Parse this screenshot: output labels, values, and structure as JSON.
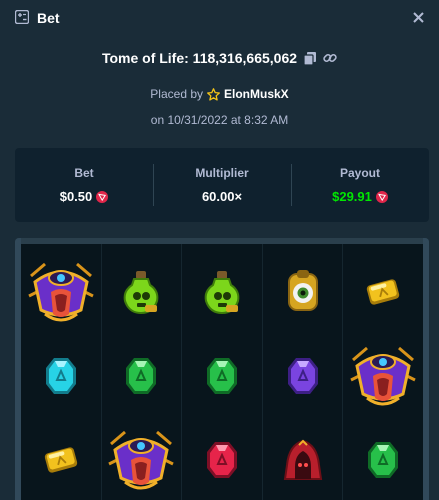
{
  "header": {
    "title": "Bet",
    "icon": "bet-icon",
    "close_icon": "close-icon"
  },
  "game": {
    "title": "Tome of Life: 118,316,665,062",
    "copy_icon": "copy-icon",
    "link_icon": "link-icon"
  },
  "placed": {
    "prefix": "Placed by",
    "user": "ElonMuskX",
    "user_icon": "star-icon"
  },
  "date": "on 10/31/2022 at 8:32 AM",
  "stats": {
    "bet": {
      "label": "Bet",
      "value": "$0.50"
    },
    "multiplier": {
      "label": "Multiplier",
      "value": "60.00×"
    },
    "payout": {
      "label": "Payout",
      "value": "$29.91"
    },
    "currency_icon": "tron-coin-icon"
  },
  "reels": [
    [
      "eye-idol-symbol",
      "cyan-gem-symbol",
      "yellow-gem-symbol"
    ],
    [
      "green-potion-symbol",
      "green-gem-symbol",
      "eye-idol-symbol"
    ],
    [
      "green-potion-symbol",
      "green-gem-symbol",
      "red-gem-symbol"
    ],
    [
      "eye-amulet-symbol",
      "purple-gem-symbol",
      "red-hood-symbol"
    ],
    [
      "yellow-gem-symbol",
      "eye-idol-symbol",
      "green-gem-symbol"
    ]
  ],
  "colors": {
    "background": "#1a2c38",
    "panel": "#0f212e",
    "muted_text": "#b1bad3",
    "payout_green": "#00e701",
    "coin_red": "#e0264a"
  }
}
